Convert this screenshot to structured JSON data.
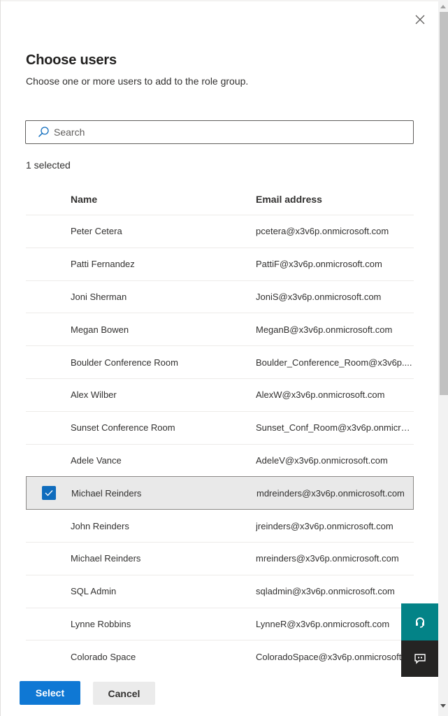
{
  "dialog": {
    "title": "Choose users",
    "subtitle": "Choose one or more users to add to the role group.",
    "close_icon": "close-icon"
  },
  "search": {
    "placeholder": "Search",
    "value": "",
    "icon": "search-icon"
  },
  "selection": {
    "count_label": "1 selected"
  },
  "table": {
    "columns": [
      "Name",
      "Email address"
    ],
    "rows": [
      {
        "name": "Peter Cetera",
        "email": "pcetera@x3v6p.onmicrosoft.com",
        "selected": false
      },
      {
        "name": "Patti Fernandez",
        "email": "PattiF@x3v6p.onmicrosoft.com",
        "selected": false
      },
      {
        "name": "Joni Sherman",
        "email": "JoniS@x3v6p.onmicrosoft.com",
        "selected": false
      },
      {
        "name": "Megan Bowen",
        "email": "MeganB@x3v6p.onmicrosoft.com",
        "selected": false
      },
      {
        "name": "Boulder Conference Room",
        "email": "Boulder_Conference_Room@x3v6p....",
        "selected": false
      },
      {
        "name": "Alex Wilber",
        "email": "AlexW@x3v6p.onmicrosoft.com",
        "selected": false
      },
      {
        "name": "Sunset Conference Room",
        "email": "Sunset_Conf_Room@x3v6p.onmicro...",
        "selected": false
      },
      {
        "name": "Adele Vance",
        "email": "AdeleV@x3v6p.onmicrosoft.com",
        "selected": false
      },
      {
        "name": "Michael Reinders",
        "email": "mdreinders@x3v6p.onmicrosoft.com",
        "selected": true
      },
      {
        "name": "John Reinders",
        "email": "jreinders@x3v6p.onmicrosoft.com",
        "selected": false
      },
      {
        "name": "Michael Reinders",
        "email": "mreinders@x3v6p.onmicrosoft.com",
        "selected": false
      },
      {
        "name": "SQL Admin",
        "email": "sqladmin@x3v6p.onmicrosoft.com",
        "selected": false
      },
      {
        "name": "Lynne Robbins",
        "email": "LynneR@x3v6p.onmicrosoft.com",
        "selected": false
      },
      {
        "name": "Colorado Space",
        "email": "ColoradoSpace@x3v6p.onmicrosoft.com",
        "selected": false
      }
    ]
  },
  "footer": {
    "select_label": "Select",
    "cancel_label": "Cancel"
  },
  "floating": {
    "help_icon": "headset-icon",
    "feedback_icon": "feedback-icon"
  },
  "colors": {
    "primary": "#0f78d4",
    "checkbox": "#0f6cbd",
    "help_button": "#038387",
    "feedback_button": "#252423",
    "selected_row": "#e9e9e9"
  }
}
